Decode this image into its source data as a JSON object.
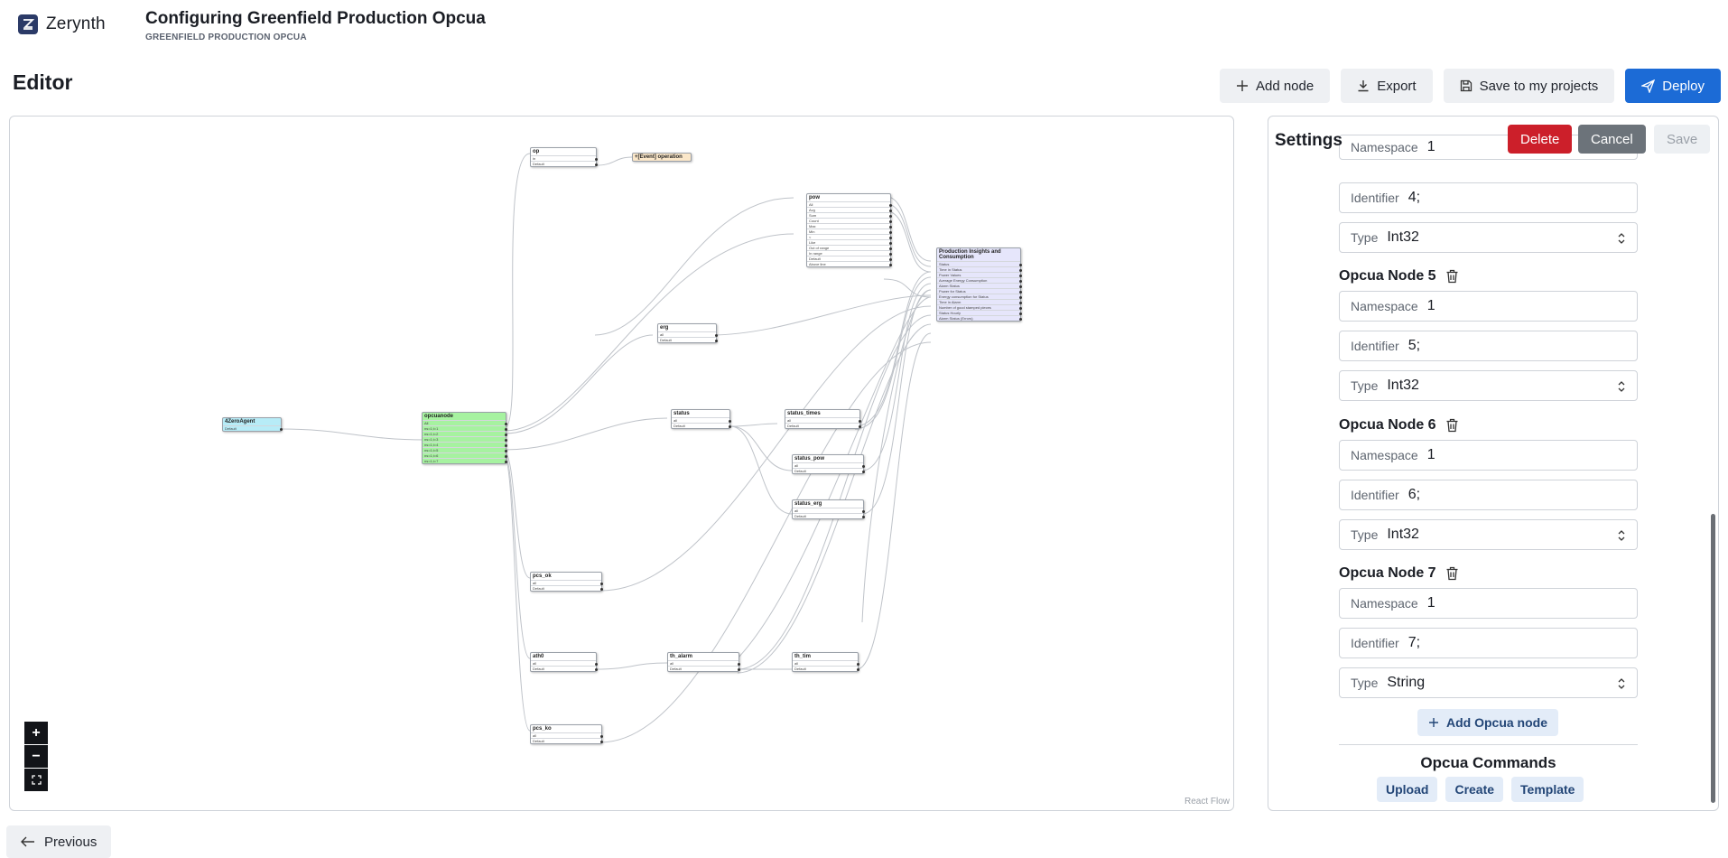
{
  "app": {
    "name": "Zerynth",
    "logo_icon": "zerynth-logo-icon"
  },
  "header": {
    "title": "Configuring Greenfield Production Opcua",
    "subtitle": "GREENFIELD PRODUCTION OPCUA"
  },
  "editor": {
    "heading": "Editor"
  },
  "toolbar": {
    "add_node": "Add node",
    "export": "Export",
    "save_projects": "Save to my projects",
    "deploy": "Deploy"
  },
  "colors": {
    "primary": "#1c6bd6",
    "danger": "#cc1f2a",
    "secondary": "#6c737a",
    "agent_node": "#b7ecf7",
    "opcua_node": "#a6f2a0",
    "insights_node": "#e6e6fb",
    "event_node": "#fbe7c9"
  },
  "canvas": {
    "attribution": "React Flow",
    "zoom": {
      "in": "+",
      "out": "−",
      "fit": "⛶"
    },
    "nodes": [
      {
        "id": "op",
        "title": "op",
        "rows": [
          "in",
          "Default"
        ]
      },
      {
        "id": "event",
        "title": "+[Event] operation",
        "rows": []
      },
      {
        "id": "pow",
        "title": "pow",
        "rows": [
          "All",
          "Avg",
          "Sum",
          "Count",
          "Max",
          "Min",
          "<",
          "Like",
          "Out of range",
          "In range",
          "Default",
          "Above line"
        ]
      },
      {
        "id": "insights",
        "title": "Production Insights and Consumption",
        "rows": [
          "Status",
          "Time in Status",
          "Power Values",
          "Average Energy Consumption",
          "Alarm Status",
          "Power for Status",
          "Energy consumption for Status",
          "Time in Alarm",
          "Number of good stamped pieces",
          "Status Hourly",
          "Alarm Status (Errors)"
        ]
      },
      {
        "id": "erg",
        "title": "erg",
        "rows": [
          "all",
          "Default"
        ]
      },
      {
        "id": "agent",
        "title": "4ZeroAgent",
        "rows": [
          "Default"
        ]
      },
      {
        "id": "opcuanode",
        "title": "opcuanode",
        "rows": [
          "All",
          "ns=1;i=1",
          "ns=1;i=2",
          "ns=1;i=3",
          "ns=1;i=4",
          "ns=1;i=5",
          "ns=1;i=6",
          "ns=1;i=7"
        ]
      },
      {
        "id": "status",
        "title": "status",
        "rows": [
          "all",
          "Default"
        ]
      },
      {
        "id": "status_times",
        "title": "status_times",
        "rows": [
          "all",
          "Default"
        ]
      },
      {
        "id": "status_pow",
        "title": "status_pow",
        "rows": [
          "all",
          "Default"
        ]
      },
      {
        "id": "status_erg",
        "title": "status_erg",
        "rows": [
          "all",
          "Default"
        ]
      },
      {
        "id": "pcs_ok",
        "title": "pcs_ok",
        "rows": [
          "all",
          "Default"
        ]
      },
      {
        "id": "ath0",
        "title": "ath0",
        "rows": [
          "all",
          "Default"
        ]
      },
      {
        "id": "th_alarm",
        "title": "th_alarm",
        "rows": [
          "all",
          "Default"
        ]
      },
      {
        "id": "th_tim",
        "title": "th_tim",
        "rows": [
          "all",
          "Default"
        ]
      },
      {
        "id": "pcs_ko",
        "title": "pcs_ko",
        "rows": [
          "all",
          "Default"
        ]
      }
    ]
  },
  "settings": {
    "title": "Settings",
    "delete": "Delete",
    "cancel": "Cancel",
    "save": "Save",
    "partial_top": {
      "namespace_label": "Namespace",
      "namespace_value": "1",
      "identifier_label": "Identifier",
      "identifier_value": "4;",
      "type_label": "Type",
      "type_value": "Int32"
    },
    "opcua_nodes": [
      {
        "heading": "Opcua Node 5",
        "namespace_label": "Namespace",
        "namespace": "1",
        "identifier_label": "Identifier",
        "identifier": "5;",
        "type_label": "Type",
        "type": "Int32"
      },
      {
        "heading": "Opcua Node 6",
        "namespace_label": "Namespace",
        "namespace": "1",
        "identifier_label": "Identifier",
        "identifier": "6;",
        "type_label": "Type",
        "type": "Int32"
      },
      {
        "heading": "Opcua Node 7",
        "namespace_label": "Namespace",
        "namespace": "1",
        "identifier_label": "Identifier",
        "identifier": "7;",
        "type_label": "Type",
        "type": "String"
      }
    ],
    "add_node": "Add Opcua node",
    "commands_title": "Opcua Commands",
    "commands": {
      "upload": "Upload",
      "create": "Create",
      "template": "Template"
    }
  },
  "footer": {
    "previous": "Previous"
  }
}
